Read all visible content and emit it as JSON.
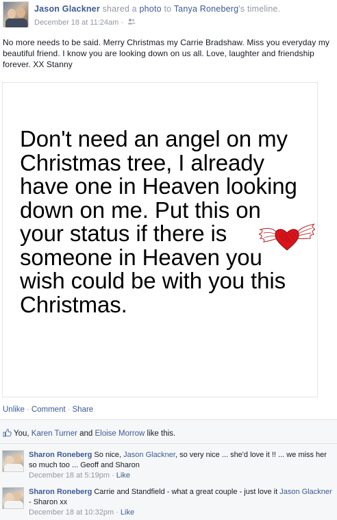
{
  "post": {
    "author": "Jason Glackner",
    "action_text": " shared a ",
    "object_link": "photo",
    "to_text": " to ",
    "target": "Tanya Roneberg",
    "target_suffix": "'s timeline.",
    "timestamp": "December 18 at 11:24am",
    "separator": " · ",
    "privacy_icon": "friends-icon",
    "text": "No more needs to be said. Merry Christmas my Carrie Bradshaw. Miss you everyday my beautiful friend. I know you are looking down on us all. Love, laughter and friendship forever. XX Stanny"
  },
  "photo": {
    "quote_lines": [
      "Don't need an angel on my",
      "Christmas tree, I already",
      "have one in Heaven looking",
      "down on me. Put this on",
      "your status if there is",
      "someone in Heaven you",
      "wish could be with you this",
      "Christmas."
    ],
    "decoration": "winged-heart-icon"
  },
  "actions": {
    "unlike": "Unlike",
    "comment": "Comment",
    "share": "Share",
    "dot": "·"
  },
  "likes": {
    "icon": "thumbs-up-icon",
    "prefix": "You, ",
    "person1": "Karen Turner",
    "and": " and ",
    "person2": "Eloise Morrow",
    "suffix": " like this."
  },
  "comments": [
    {
      "author": "Sharon Roneberg",
      "text_before": " So nice, ",
      "mention": "Jason Glackner",
      "text_after": ", so very nice ... she'd love it !! ... we miss her so much too ... Geoff and Sharon",
      "timestamp": "December 18 at 5:19pm",
      "separator": " · ",
      "like_label": "Like"
    },
    {
      "author": "Sharon Roneberg",
      "text_before": " Carrie and Standfield - what a great couple - just love it ",
      "mention": "Jason Glackner",
      "text_after": " - Sharon xx",
      "timestamp": "December 18 at 10:32pm",
      "separator": " · ",
      "like_label": "Like"
    }
  ],
  "colors": {
    "link": "#3b5998",
    "meta": "#9197a3",
    "ufi_background": "#f6f7f8",
    "heart": "#d9141c"
  }
}
